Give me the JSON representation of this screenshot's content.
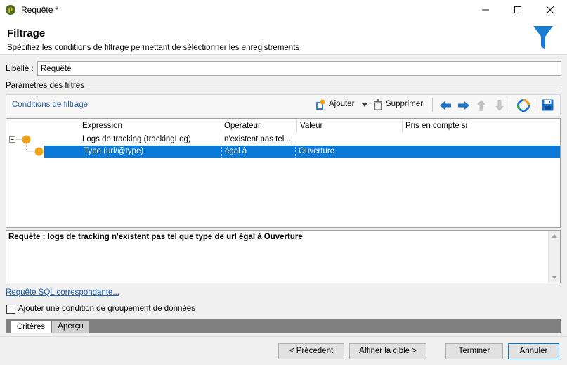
{
  "window": {
    "title": "Requête *",
    "minimize": "—",
    "maximize": "☐",
    "close": "✕"
  },
  "header": {
    "title": "Filtrage",
    "subtitle": "Spécifiez les conditions de filtrage permettant de sélectionner les enregistrements",
    "icon": "funnel-icon"
  },
  "form": {
    "label_text": "Libellé :",
    "label_value": "Requête",
    "section_title": "Paramètres des filtres"
  },
  "toolbar": {
    "title": "Conditions de filtrage",
    "add_label": "Ajouter",
    "delete_label": "Supprimer"
  },
  "grid": {
    "columns": [
      "Expression",
      "Opérateur",
      "Valeur",
      "Pris en compte si"
    ],
    "rows": [
      {
        "expression": "Logs de tracking (trackingLog)",
        "operator": "n'existent pas tel ...",
        "value": "",
        "condition": ""
      },
      {
        "expression": "Type (url/@type)",
        "operator": "égal à",
        "value": "Ouverture",
        "condition": ""
      }
    ]
  },
  "description": "Requête : logs de tracking n'existent pas tel que type de url égal à Ouverture",
  "sql_link": "Requête SQL correspondante...",
  "grouping_checkbox": "Ajouter une condition de groupement de données",
  "tabs": [
    "Critères",
    "Aperçu"
  ],
  "buttons": {
    "previous": "< Précédent",
    "next": "Affiner la cible >",
    "finish": "Terminer",
    "cancel": "Annuler"
  },
  "colors": {
    "accent": "#0a78d7",
    "funnel": "#1c7ccf",
    "node": "#f0a31a"
  }
}
